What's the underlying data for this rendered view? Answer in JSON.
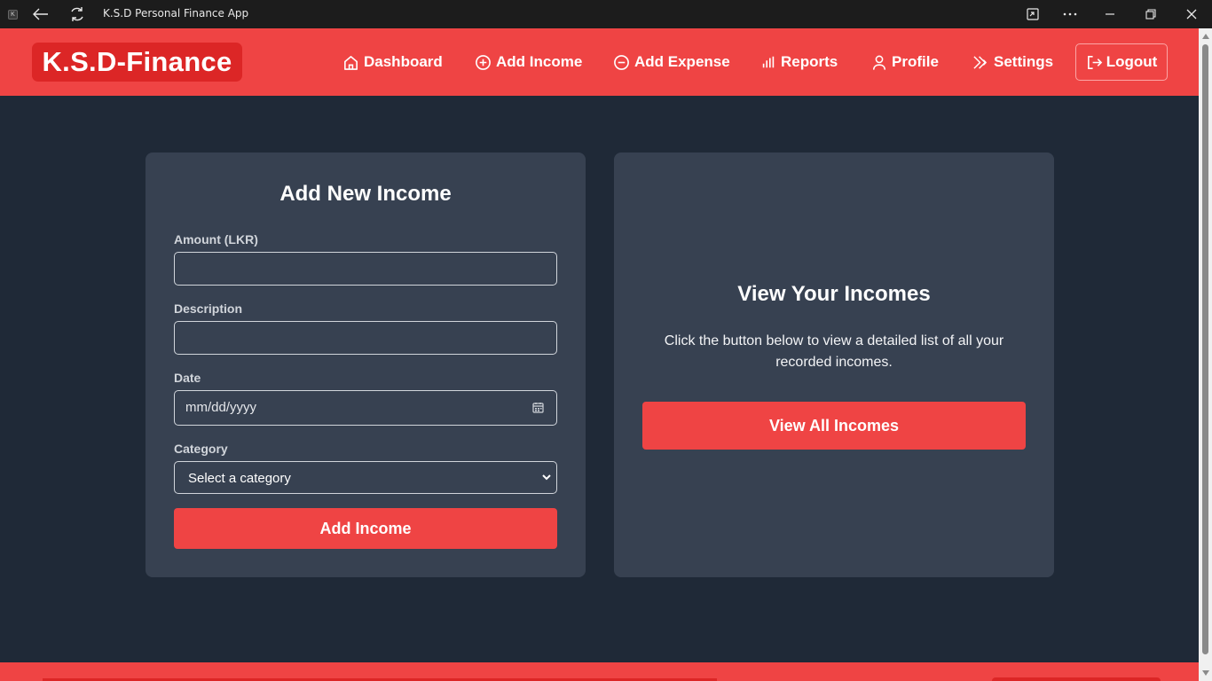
{
  "window": {
    "title": "K.S.D Personal Finance App",
    "app_icon_letter": "K"
  },
  "navbar": {
    "logo": "K.S.D-Finance",
    "items": [
      {
        "label": "Dashboard",
        "icon": "home-icon"
      },
      {
        "label": "Add Income",
        "icon": "plus-circle-icon"
      },
      {
        "label": "Add Expense",
        "icon": "minus-circle-icon"
      },
      {
        "label": "Reports",
        "icon": "bar-chart-icon"
      },
      {
        "label": "Profile",
        "icon": "user-icon"
      },
      {
        "label": "Settings",
        "icon": "settings-icon"
      }
    ],
    "logout_label": "Logout"
  },
  "income_form": {
    "title": "Add New Income",
    "amount_label": "Amount (LKR)",
    "amount_value": "",
    "description_label": "Description",
    "description_value": "",
    "date_label": "Date",
    "date_placeholder": "mm/dd/yyyy",
    "category_label": "Category",
    "category_selected": "Select a category",
    "submit_label": "Add Income"
  },
  "view_card": {
    "title": "View Your Incomes",
    "description": "Click the button below to view a detailed list of all your recorded incomes.",
    "button_label": "View All Incomes"
  },
  "colors": {
    "accent": "#ef4444",
    "accent_dark": "#dc2626",
    "background": "#1f2937",
    "card": "#374151"
  }
}
